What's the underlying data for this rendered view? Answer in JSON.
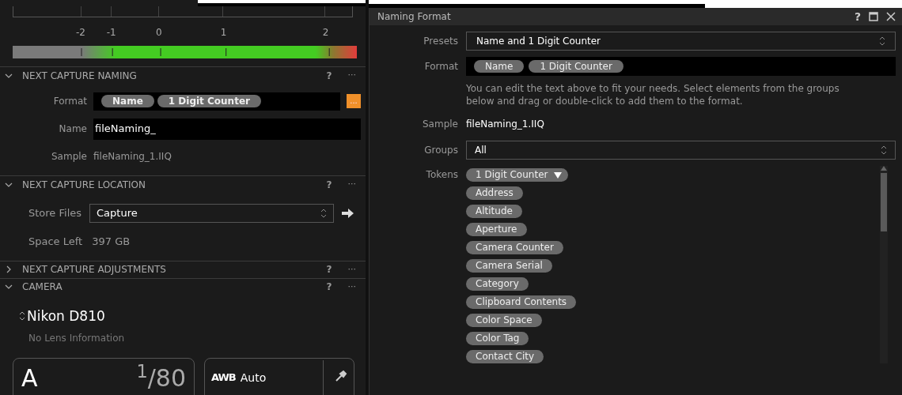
{
  "left": {
    "scale_labels": [
      "-2",
      "-1",
      "0",
      "1",
      "2"
    ],
    "sections": [
      {
        "kind": "naming",
        "title": "NEXT CAPTURE NAMING",
        "expanded": true,
        "help": "?",
        "menu": "···",
        "format_label": "Format",
        "format_tokens": [
          "Name",
          "1 Digit Counter"
        ],
        "format_button": "...",
        "name_label": "Name",
        "name_value": "fileNaming_",
        "sample_label": "Sample",
        "sample_value": "fileNaming_1.IIQ"
      },
      {
        "kind": "location",
        "title": "NEXT CAPTURE LOCATION",
        "expanded": true,
        "help": "?",
        "menu": "···",
        "store_label": "Store Files",
        "store_value": "Capture",
        "space_label": "Space Left",
        "space_value": "397 GB"
      },
      {
        "kind": "adjustments",
        "title": "NEXT CAPTURE ADJUSTMENTS",
        "expanded": false,
        "help": "?",
        "menu": "···"
      },
      {
        "kind": "camera",
        "title": "CAMERA",
        "expanded": true,
        "help": "?",
        "menu": "···",
        "model": "Nikon D810",
        "lens": "No Lens Information",
        "mode": "A",
        "shutter": "$^{1}$/80",
        "wb_badge": "AWB",
        "wb_value": "Auto"
      }
    ]
  },
  "dialog": {
    "title": "Naming Format",
    "help": "?",
    "presets_label": "Presets",
    "presets_value": "Name and 1 Digit Counter",
    "format_label": "Format",
    "format_tokens": [
      "Name",
      "1 Digit Counter"
    ],
    "hint": "You can edit the text above to fit your needs. Select elements from the groups below and drag or double-click to add them to the format.",
    "sample_label": "Sample",
    "sample_value": "fileNaming_1.IIQ",
    "groups_label": "Groups",
    "groups_value": "All",
    "tokens_label": "Tokens",
    "tokens": [
      {
        "label": "1 Digit Counter",
        "kind": "dropdown"
      },
      {
        "label": "Address",
        "kind": "plain"
      },
      {
        "label": "Altitude",
        "kind": "plain"
      },
      {
        "label": "Aperture",
        "kind": "plain"
      },
      {
        "label": "Camera Counter",
        "kind": "plain"
      },
      {
        "label": "Camera Serial",
        "kind": "plain"
      },
      {
        "label": "Category",
        "kind": "plain"
      },
      {
        "label": "Clipboard Contents",
        "kind": "plain"
      },
      {
        "label": "Color Space",
        "kind": "plain"
      },
      {
        "label": "Color Tag",
        "kind": "plain"
      },
      {
        "label": "Contact City",
        "kind": "plain"
      }
    ]
  }
}
